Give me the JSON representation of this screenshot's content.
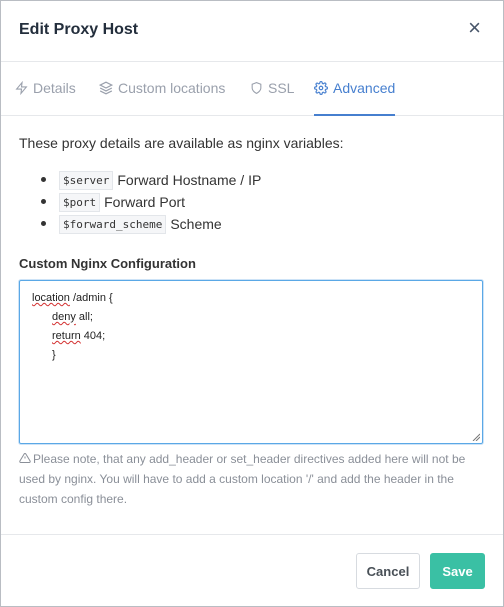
{
  "modal": {
    "title": "Edit Proxy Host",
    "close_label": "×"
  },
  "tabs": [
    {
      "label": "Details",
      "icon": "bolt-icon"
    },
    {
      "label": "Custom locations",
      "icon": "layers-icon"
    },
    {
      "label": "SSL",
      "icon": "shield-icon"
    },
    {
      "label": "Advanced",
      "icon": "gear-icon",
      "active": true
    }
  ],
  "intro": "These proxy details are available as nginx variables:",
  "variables": [
    {
      "code": "$server",
      "desc": "Forward Hostname / IP"
    },
    {
      "code": "$port",
      "desc": "Forward Port"
    },
    {
      "code": "$forward_scheme",
      "desc": "Scheme"
    }
  ],
  "config": {
    "label": "Custom Nginx Configuration",
    "lines": [
      "location /admin {",
      "deny all;",
      "return 404;",
      "}"
    ]
  },
  "note": "Please note, that any add_header or set_header directives added here will not be used by nginx. You will have to add a custom location '/' and add the header in the custom config there.",
  "footer": {
    "cancel_label": "Cancel",
    "save_label": "Save"
  },
  "colors": {
    "accent": "#467fcf",
    "save": "#3ac0a4"
  }
}
